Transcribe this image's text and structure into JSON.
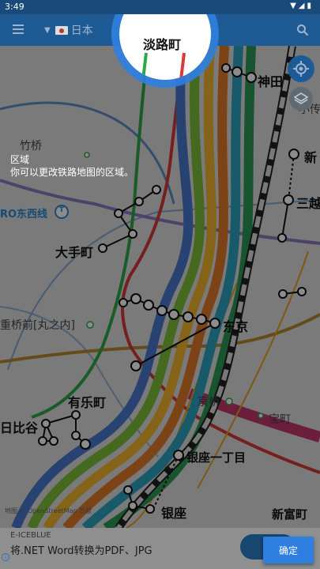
{
  "status_bar": {
    "time": "3:49",
    "icons": [
      "wifi-icon",
      "signal-icon",
      "battery-icon"
    ]
  },
  "app_bar": {
    "region_label": "日本",
    "menu_icon": "menu-icon",
    "search_icon": "search-icon"
  },
  "spotlight": {
    "station": "淡路町"
  },
  "hint": {
    "title": "区域",
    "description": "你可以更改铁路地图的区域。"
  },
  "map": {
    "line_label": "RO东西线",
    "line_badge": "T",
    "stations": {
      "kanda": "神田",
      "ogawamachi": "小传",
      "takebashi": "竹桥",
      "shin": "新",
      "mitsukoshi": "三越",
      "otemachi": "大手町",
      "nijubashimae": "重桥前[丸之内]",
      "tokyo": "东京",
      "yurakucho": "有乐町",
      "kyobashi": "京桥",
      "takaracho": "宝町",
      "hibiya": "日比谷",
      "ginza_itchome": "银座一丁目",
      "ginza": "银座",
      "shintomicho": "新富町"
    },
    "attribution": "地图 © OpenStreetMap 贡献",
    "fab_location_icon": "crosshair-icon",
    "fab_layers_icon": "layers-icon"
  },
  "ad": {
    "source": "E-ICEBLUE",
    "text": "将.NET Word转换为PDF、JPG",
    "info_icon": "i"
  },
  "confirm_button": "确定",
  "colors": {
    "accent": "#2f7fe0",
    "app_bar": "#1e5a93",
    "status_bar": "#1a4a7a"
  }
}
